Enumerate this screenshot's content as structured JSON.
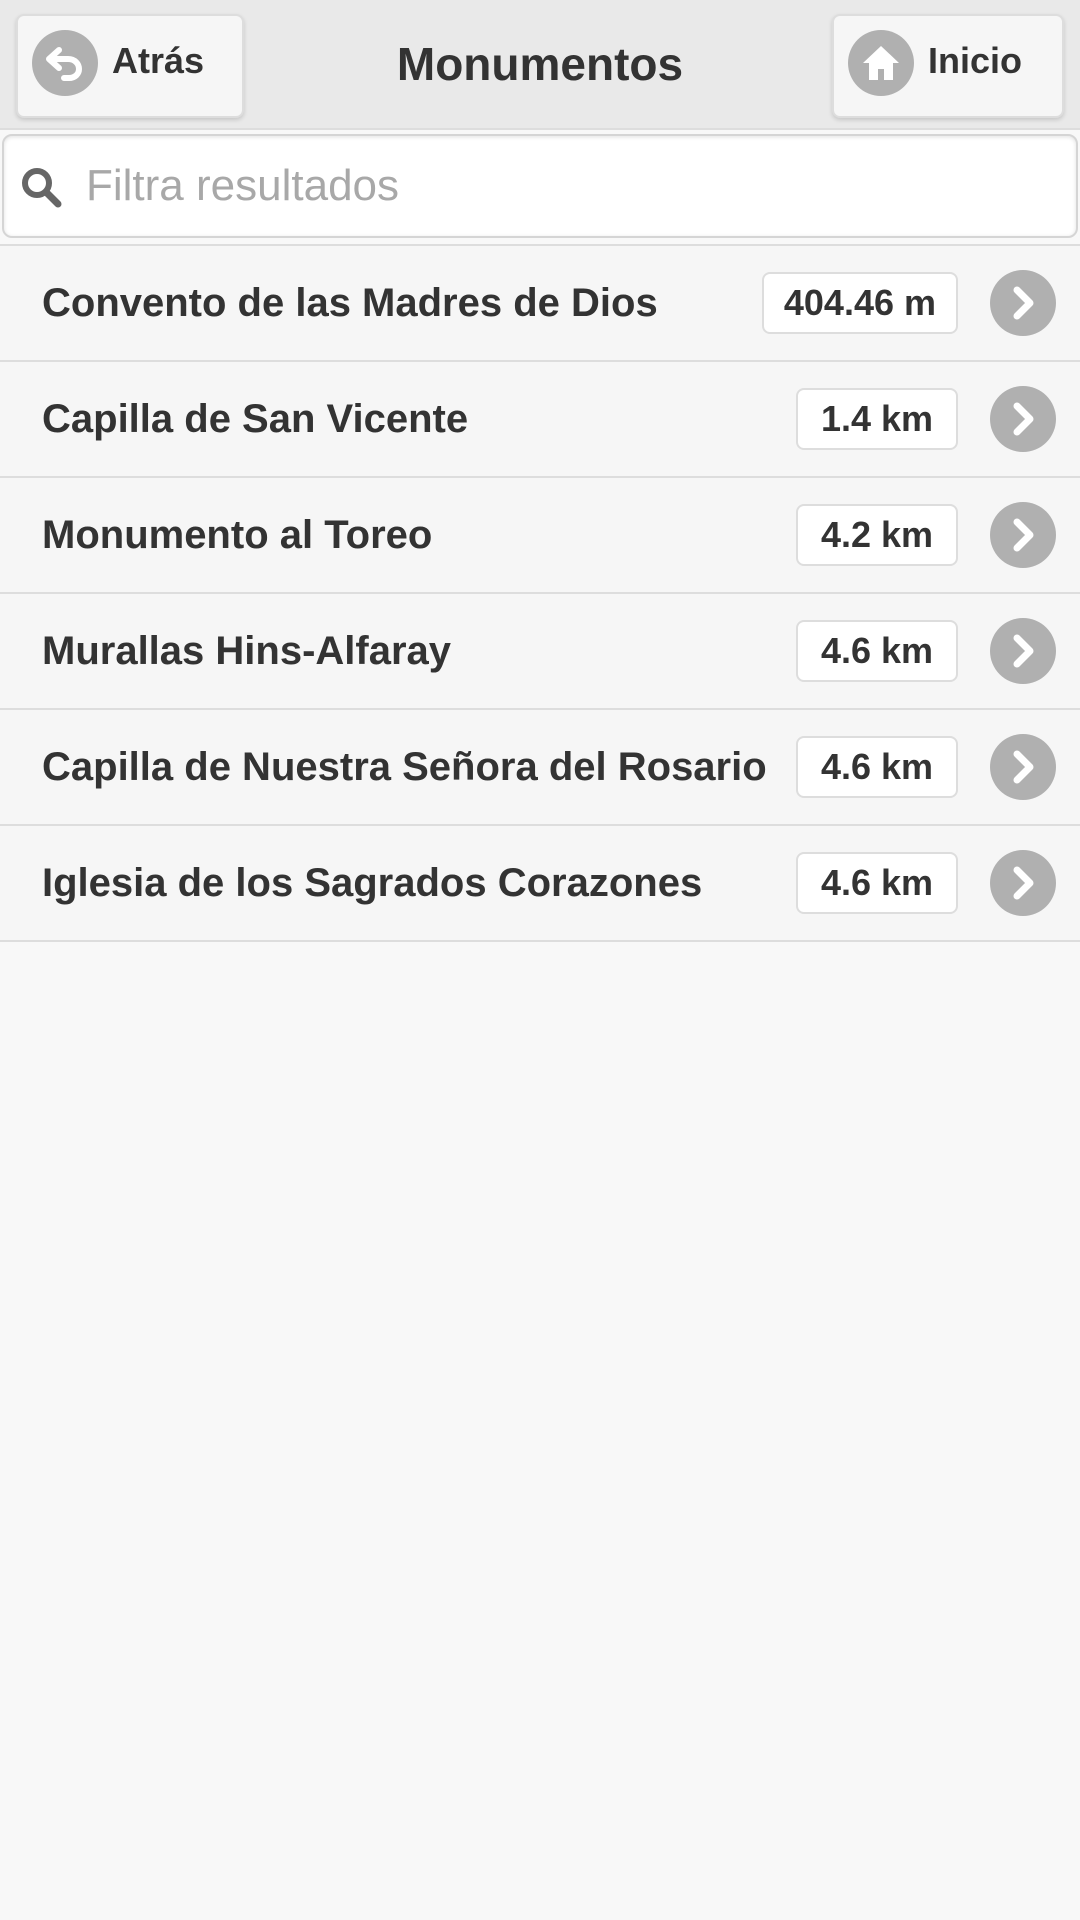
{
  "header": {
    "title": "Monumentos",
    "back_label": "Atrás",
    "home_label": "Inicio"
  },
  "search": {
    "placeholder": "Filtra resultados",
    "value": ""
  },
  "items": [
    {
      "name": "Convento de las Madres de Dios",
      "distance": "404.46 m"
    },
    {
      "name": "Capilla de San Vicente",
      "distance": "1.4 km"
    },
    {
      "name": "Monumento al Toreo",
      "distance": "4.2 km"
    },
    {
      "name": "Murallas Hins-Alfaray",
      "distance": "4.6 km"
    },
    {
      "name": "Capilla de Nuestra Señora del Rosario",
      "distance": "4.6 km"
    },
    {
      "name": "Iglesia de los Sagrados Corazones",
      "distance": "4.6 km"
    }
  ],
  "icons": {
    "back": "back-arrow-icon",
    "home": "home-icon",
    "search": "search-icon",
    "row_arrow": "chevron-right-icon"
  },
  "colors": {
    "header_bg": "#e9e9e9",
    "page_bg": "#f8f8f8",
    "row_bg": "#f6f6f6",
    "icon_circle": "#b0b0b0",
    "text": "#333333",
    "placeholder": "#a8a8a8"
  }
}
